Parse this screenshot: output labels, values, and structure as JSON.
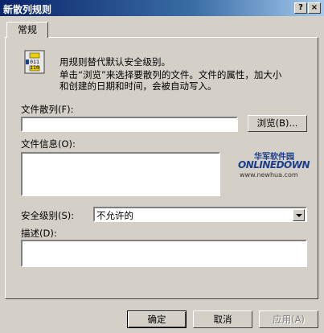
{
  "window": {
    "title": "新散列规则",
    "help_glyph": "?",
    "close_glyph": "×"
  },
  "tab": {
    "label": "常规"
  },
  "description": {
    "line1": "用规则替代默认安全级别。",
    "line2": "单击“浏览”来选择要散列的文件。文件的属性，加大小",
    "line3": "和创建的日期和时间，会被自动写入。"
  },
  "file_hash": {
    "label": "文件散列(F):",
    "value": "",
    "browse_label": "浏览(B)..."
  },
  "file_info": {
    "label": "文件信息(O):",
    "value": ""
  },
  "security_level": {
    "label": "安全级别(S):",
    "selected": "不允许的"
  },
  "description_field": {
    "label": "描述(D):",
    "value": ""
  },
  "buttons": {
    "ok": "确定",
    "cancel": "取消",
    "apply": "应用(A)"
  },
  "watermark": {
    "line1": "华军软件园",
    "line2": "ONLINEDOWN",
    "line3": "www.newhua.com"
  },
  "colors": {
    "title_start": "#0a246a",
    "title_end": "#a6caf0",
    "face": "#d4d0c8"
  }
}
